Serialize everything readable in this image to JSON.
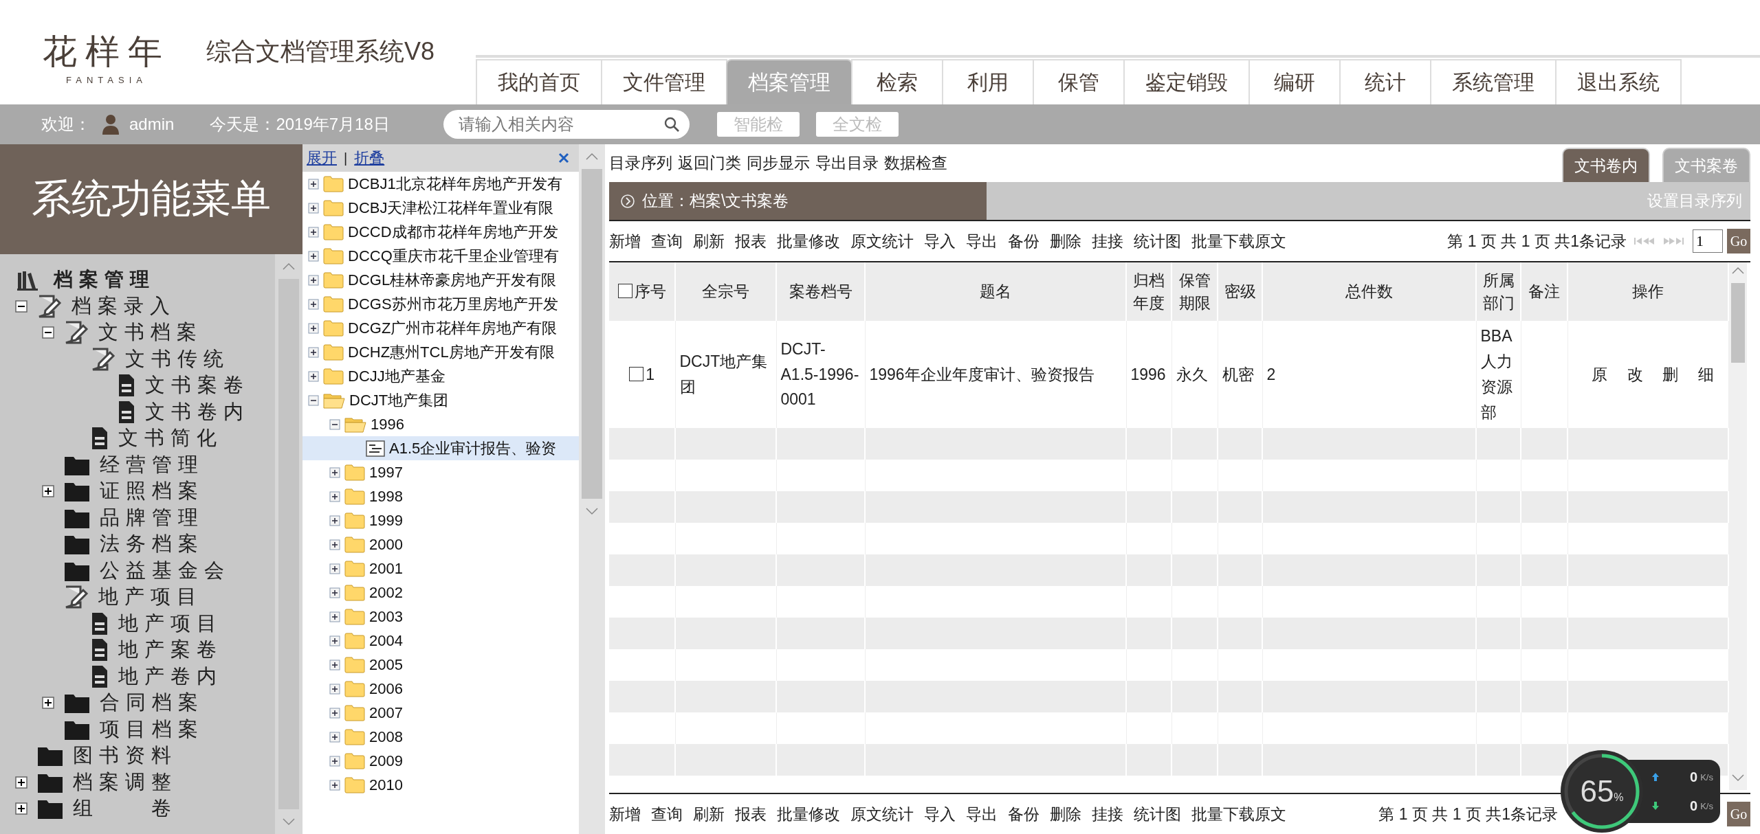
{
  "logo": {
    "mark": "花样年",
    "sub": "FANTASIA"
  },
  "app_title": "综合文档管理系统V8",
  "nav": {
    "tabs": [
      {
        "label": "我的首页",
        "selected": false
      },
      {
        "label": "文件管理",
        "selected": false
      },
      {
        "label": "档案管理",
        "selected": true
      },
      {
        "label": "检索",
        "selected": false
      },
      {
        "label": "利用",
        "selected": false
      },
      {
        "label": "保管",
        "selected": false
      },
      {
        "label": "鉴定销毁",
        "selected": false
      },
      {
        "label": "编研",
        "selected": false
      },
      {
        "label": "统计",
        "selected": false
      },
      {
        "label": "系统管理",
        "selected": false
      },
      {
        "label": "退出系统",
        "selected": false
      }
    ]
  },
  "user_bar": {
    "welcome": "欢迎：",
    "user": "admin",
    "date": "今天是：2019年7月18日",
    "search": {
      "placeholder": "请输入相关内容"
    },
    "buttons": [
      "智能检",
      "全文检"
    ]
  },
  "menu": {
    "title": "系统功能菜单",
    "items": [
      {
        "label": "档案管理",
        "kind": "books",
        "children": [
          {
            "label": "档案录入",
            "kind": "edit",
            "expanded": true,
            "children": [
              {
                "label": "文书档案",
                "kind": "edit",
                "expanded": true,
                "children": [
                  {
                    "label": "文书传统",
                    "kind": "edit",
                    "children": [
                      {
                        "label": "文书案卷",
                        "kind": "doc"
                      },
                      {
                        "label": "文书卷内",
                        "kind": "doc"
                      }
                    ]
                  },
                  {
                    "label": "文书简化",
                    "kind": "doc"
                  }
                ]
              },
              {
                "label": "经营管理",
                "kind": "folder"
              },
              {
                "label": "证照档案",
                "kind": "folder",
                "expanded": false
              },
              {
                "label": "品牌管理",
                "kind": "folder"
              },
              {
                "label": "法务档案",
                "kind": "folder"
              },
              {
                "label": "公益基金会",
                "kind": "folder"
              },
              {
                "label": "地产项目",
                "kind": "edit",
                "children": [
                  {
                    "label": "地产项目",
                    "kind": "doc"
                  },
                  {
                    "label": "地产案卷",
                    "kind": "doc"
                  },
                  {
                    "label": "地产卷内",
                    "kind": "doc"
                  }
                ]
              },
              {
                "label": "合同档案",
                "kind": "folder",
                "expanded": false
              },
              {
                "label": "项目档案",
                "kind": "folder"
              }
            ]
          },
          {
            "label": "图书资料",
            "kind": "folder"
          },
          {
            "label": "档案调整",
            "kind": "folder",
            "expanded": false
          },
          {
            "label": "组　　卷",
            "kind": "folder",
            "expanded": false
          }
        ]
      }
    ]
  },
  "tree": {
    "expand": "展开",
    "separator": "|",
    "collapse": "折叠",
    "items": [
      {
        "label": "DCBJ1北京花样年房地产开发有",
        "kind": "folder",
        "expanded": false,
        "selected": false
      },
      {
        "label": "DCBJ天津松江花样年置业有限",
        "kind": "folder",
        "expanded": false,
        "selected": false
      },
      {
        "label": "DCCD成都市花样年房地产开发",
        "kind": "folder",
        "expanded": false,
        "selected": false
      },
      {
        "label": "DCCQ重庆市花千里企业管理有",
        "kind": "folder",
        "expanded": false,
        "selected": false
      },
      {
        "label": "DCGL桂林帝豪房地产开发有限",
        "kind": "folder",
        "expanded": false,
        "selected": false
      },
      {
        "label": "DCGS苏州市花万里房地产开发",
        "kind": "folder",
        "expanded": false,
        "selected": false
      },
      {
        "label": "DCGZ广州市花样年房地产有限",
        "kind": "folder",
        "expanded": false,
        "selected": false
      },
      {
        "label": "DCHZ惠州TCL房地产开发有限",
        "kind": "folder",
        "expanded": false,
        "selected": false
      },
      {
        "label": "DCJJ地产基金",
        "kind": "folder",
        "expanded": false,
        "selected": false
      },
      {
        "label": "DCJT地产集团",
        "kind": "folder",
        "expanded": true,
        "selected": false,
        "children": [
          {
            "label": "1996",
            "kind": "folder",
            "expanded": true,
            "selected": false,
            "children": [
              {
                "label": "A1.5企业审计报告、验资",
                "kind": "file",
                "selected": true
              }
            ]
          },
          {
            "label": "1997",
            "kind": "folder",
            "expanded": false,
            "selected": false
          },
          {
            "label": "1998",
            "kind": "folder",
            "expanded": false,
            "selected": false
          },
          {
            "label": "1999",
            "kind": "folder",
            "expanded": false,
            "selected": false
          },
          {
            "label": "2000",
            "kind": "folder",
            "expanded": false,
            "selected": false
          },
          {
            "label": "2001",
            "kind": "folder",
            "expanded": false,
            "selected": false
          },
          {
            "label": "2002",
            "kind": "folder",
            "expanded": false,
            "selected": false
          },
          {
            "label": "2003",
            "kind": "folder",
            "expanded": false,
            "selected": false
          },
          {
            "label": "2004",
            "kind": "folder",
            "expanded": false,
            "selected": false
          },
          {
            "label": "2005",
            "kind": "folder",
            "expanded": false,
            "selected": false
          },
          {
            "label": "2006",
            "kind": "folder",
            "expanded": false,
            "selected": false
          },
          {
            "label": "2007",
            "kind": "folder",
            "expanded": false,
            "selected": false
          },
          {
            "label": "2008",
            "kind": "folder",
            "expanded": false,
            "selected": false
          },
          {
            "label": "2009",
            "kind": "folder",
            "expanded": false,
            "selected": false
          },
          {
            "label": "2010",
            "kind": "folder",
            "expanded": false,
            "selected": false
          }
        ]
      }
    ]
  },
  "main": {
    "links": [
      "目录序列",
      "返回门类",
      "同步显示",
      "导出目录",
      "数据检查"
    ],
    "tabs": [
      {
        "label": "文书卷内",
        "selected": true
      },
      {
        "label": "文书案卷",
        "selected": false
      }
    ],
    "location": "位置：档案\\文书案卷",
    "set_order": "设置目录序列",
    "toolbar": [
      "新增",
      "查询",
      "刷新",
      "报表",
      "批量修改",
      "原文统计",
      "导入",
      "导出",
      "备份",
      "删除",
      "挂接",
      "统计图",
      "批量下载原文"
    ],
    "pager": {
      "text": "第 1 页 共 1 页 共1条记录",
      "page": "1",
      "go": "Go"
    },
    "table": {
      "all_checked": false,
      "columns": [
        {
          "label": "序号",
          "kind": "check"
        },
        {
          "label": "全宗号",
          "kind": "text"
        },
        {
          "label": "案卷档号",
          "kind": "text"
        },
        {
          "label": "题名",
          "kind": "text"
        },
        {
          "label": "归档年度",
          "kind": "text"
        },
        {
          "label": "保管期限",
          "kind": "text"
        },
        {
          "label": "密级",
          "kind": "text"
        },
        {
          "label": "总件数",
          "kind": "text"
        },
        {
          "label": "所属部门",
          "kind": "text"
        },
        {
          "label": "备注",
          "kind": "text"
        },
        {
          "label": "操作",
          "kind": "actions"
        }
      ],
      "rows": [
        {
          "checked": false,
          "cells": [
            "1",
            "DCJT地产集团",
            "DCJT-A1.5-1996-0001",
            "1996年企业年度审计、验资报告",
            "1996",
            "永久",
            "机密",
            "2",
            "BBA人力资源部"
          ],
          "actions": [
            "原",
            "改",
            "删",
            "细"
          ]
        }
      ]
    },
    "bottom_toolbar": [
      "新增",
      "查询",
      "刷新",
      "报表",
      "批量修改",
      "原文统计",
      "导入",
      "导出",
      "备份",
      "删除",
      "挂接",
      "统计图",
      "批量下载原文"
    ],
    "bottom_pager": {
      "text": "第 1 页 共 1 页 共1条记录",
      "go": "Go"
    }
  },
  "net_widget": {
    "percent": "65",
    "unit": "%",
    "level": 0.65,
    "up": "0",
    "up_unit": "K/s",
    "down": "0",
    "down_unit": "K/s"
  }
}
